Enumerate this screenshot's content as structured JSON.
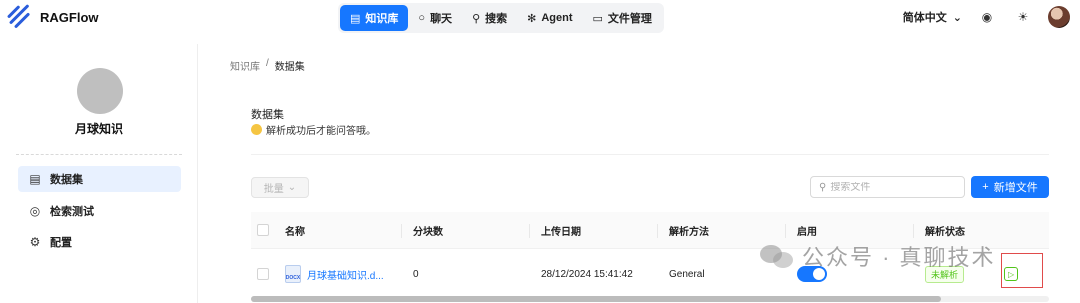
{
  "header": {
    "app_name": "RAGFlow",
    "nav": [
      {
        "label": "知识库",
        "icon": "database-icon",
        "active": true
      },
      {
        "label": "聊天",
        "icon": "chat-icon",
        "active": false
      },
      {
        "label": "搜索",
        "icon": "search-icon",
        "active": false
      },
      {
        "label": "Agent",
        "icon": "agent-icon",
        "active": false
      },
      {
        "label": "文件管理",
        "icon": "folder-icon",
        "active": false
      }
    ],
    "language": "简体中文",
    "accent_color": "#1677ff"
  },
  "sidebar": {
    "kb_name": "月球知识",
    "items": [
      {
        "label": "数据集",
        "icon": "dataset-icon",
        "active": true
      },
      {
        "label": "检索测试",
        "icon": "target-icon",
        "active": false
      },
      {
        "label": "配置",
        "icon": "gear-icon",
        "active": false
      }
    ]
  },
  "breadcrumb": {
    "root": "知识库",
    "separator": "/",
    "current": "数据集"
  },
  "section": {
    "title": "数据集",
    "description": "解析成功后才能问答哦。"
  },
  "toolbar": {
    "batch_label": "批量",
    "search_placeholder": "搜索文件",
    "add_label": "新增文件"
  },
  "table": {
    "headers": {
      "name": "名称",
      "chunks": "分块数",
      "upload_date": "上传日期",
      "parse_method": "解析方法",
      "enabled": "启用",
      "parse_status": "解析状态"
    },
    "rows": [
      {
        "file_type": "DOCX",
        "name": "月球基础知识.d...",
        "chunks": "0",
        "upload_date": "28/12/2024 15:41:42",
        "parse_method": "General",
        "enabled": true,
        "status": "未解析"
      }
    ]
  },
  "watermark": {
    "text": "公众号 · 真聊技术"
  }
}
